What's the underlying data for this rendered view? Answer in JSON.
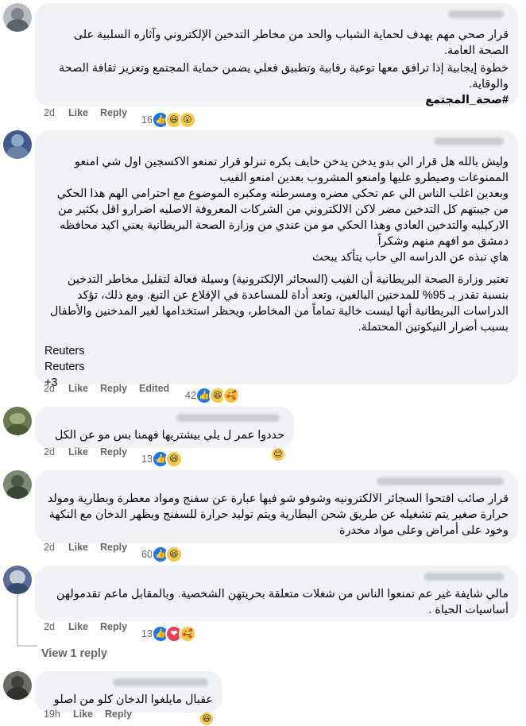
{
  "comments": [
    {
      "paragraphs": [
        "قرار صحي مهم يهدف لحماية الشباب والحد من مخاطر التدخين الإلكتروني وآثاره السلبية على الصحة العامة.",
        "خطوة إيجابية إذا ترافق معها توعية رقابية وتطبيق فعلي يضمن حماية المجتمع وتعزيز ثقافة الصحة والوقاية."
      ],
      "hashtag": "#صحة_المجتمع",
      "time": "2d",
      "like": "Like",
      "reply": "Reply",
      "reaction_count": "16",
      "reactions": [
        "like-icon",
        "haha-icon",
        "wow-icon"
      ]
    },
    {
      "paragraphs": [
        "وليش بالله هل قرار الي بدو يدخن يدخن خايف بكره تنزلو قرار تمنعو الاكسجين اول شي امنعو الممنوعات وصيطرو عليها وامنعو المشروب بعدين امنعو الفيب",
        "وبعدين اغلب الناس الي عم تحكي مضره ومسرطنه ومكبره الموضوع مع احترامي الهم هذا الحكي من جيبتهم كل التدخين مضر لاكن الالكتروني من الشركات المعروفة الاصليه اضرارو اقل بكثير من الاركيليه والتدخين العادي وهذا الحكي مو من عندي من وزارة الصحة البريطانية يعني اكيد محافظه دمشق مو افهم منهم وشكراً",
        "هاي نبذه عن الدراسه الي حاب يتأكد يبحث"
      ],
      "paragraph2": "تعتبر وزارة الصحة البريطانية أن الفيب (السجائر الإلكترونية) وسيلة فعالة لتقليل مخاطر التدخين بنسبة تقدر بـ 95% للمدخنين البالغين، وتعد أداة للمساعدة في الإقلاع عن التبغ. ومع ذلك، تؤكد الدراسات البريطانية أنها ليست خالية تماماً من المخاطر، ويحظر استخدامها لغير المدخنين والأطفال بسبب أضرار النيكوتين المحتملة.",
      "sources": [
        "Reuters",
        "Reuters",
        "+3"
      ],
      "time": "2d",
      "like": "Like",
      "reply": "Reply",
      "edited": "Edited",
      "reaction_count": "42",
      "reactions": [
        "like-icon",
        "haha-icon",
        "care-icon"
      ]
    },
    {
      "paragraphs": [
        "حددوا عمر ل يلي بيشتريها فهمنا بس مو عن الكل"
      ],
      "time": "2d",
      "like": "Like",
      "reply": "Reply",
      "reaction_count": "13",
      "reactions": [
        "like-icon",
        "haha-icon"
      ]
    },
    {
      "paragraphs": [
        "قرار صائب افتحوا السجائر الالكترونيه وشوفو شو فيها عبارة عن سفنج ومواد معطرة وبطارية ومولد حرارة صغير يتم تشغيله عن طريق شحن البطارية ويتم توليد حرارة للسفنج ويظهر الدخان مع النكهة وخود على أمراض وعلى مواد مخدرة"
      ],
      "time": "2d",
      "like": "Like",
      "reply": "Reply",
      "reaction_count": "60",
      "reactions": [
        "like-icon",
        "haha-icon"
      ]
    },
    {
      "paragraphs": [
        "مالي شايفة غير عم تمنعوا الناس من شغلات متعلقة بحريتهن الشخصية. وبالمقابل ماعم تقدمولهن أساسيات الحياة ."
      ],
      "time": "2d",
      "like": "Like",
      "reply": "Reply",
      "reaction_count": "13",
      "reactions": [
        "like-icon",
        "love-icon",
        "care-icon"
      ]
    },
    {
      "paragraphs": [
        "عقبال مايلغوا الدخان كلو من اصلو"
      ],
      "time": "19h",
      "like": "Like",
      "reply": "Reply"
    }
  ],
  "view_replies": "View 1 reply",
  "colors": {
    "bubble": "#f0f2f5",
    "meta": "#65676b",
    "like": "#1877f2",
    "love": "#f33e58",
    "haha": "#f7c94b"
  }
}
